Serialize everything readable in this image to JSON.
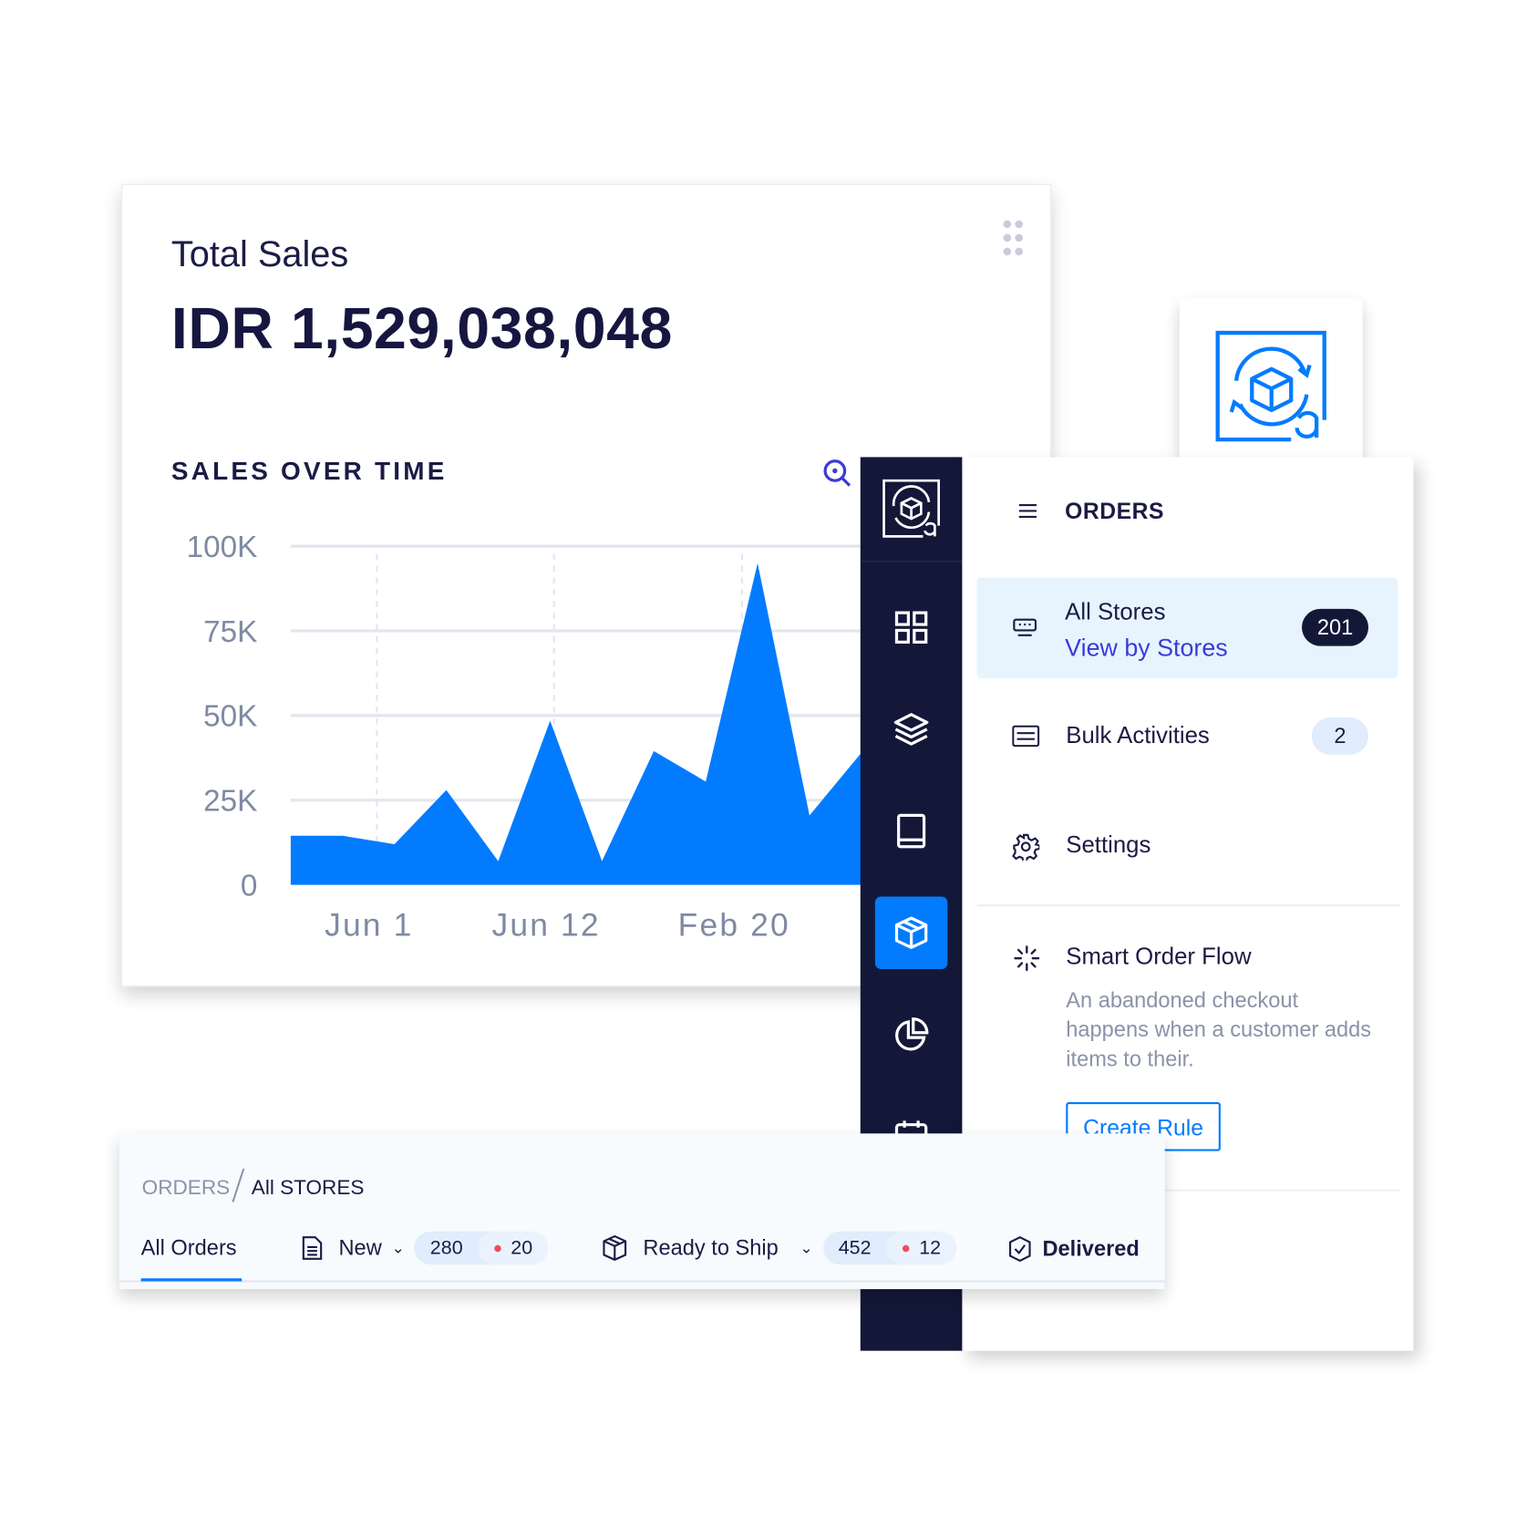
{
  "sales_card": {
    "title": "Total Sales",
    "amount": "IDR 1,529,038,048",
    "chart_title": "SALES OVER TIME"
  },
  "chart_data": {
    "type": "area",
    "title": "SALES OVER TIME",
    "y_ticks": [
      "100K",
      "75K",
      "50K",
      "25K",
      "0"
    ],
    "y_tick_values": [
      100000,
      75000,
      50000,
      25000,
      0
    ],
    "x_ticks": [
      "Jun 1",
      "Jun 12",
      "Feb 20"
    ],
    "values": [
      14500,
      14500,
      12000,
      28000,
      7000,
      48500,
      7000,
      39500,
      30500,
      95000,
      20500,
      39000
    ],
    "ylim": [
      0,
      100000
    ],
    "grid": true,
    "color": "#037bff"
  },
  "rail": {
    "items": [
      {
        "icon": "grid-icon"
      },
      {
        "icon": "layers-icon"
      },
      {
        "icon": "book-icon"
      },
      {
        "icon": "box-icon",
        "active": true
      },
      {
        "icon": "pie-chart-icon"
      },
      {
        "icon": "calendar-icon"
      }
    ]
  },
  "panel": {
    "header": "ORDERS",
    "items": [
      {
        "label": "All Stores",
        "link": "View by Stores",
        "badge": "201"
      },
      {
        "label": "Bulk Activities",
        "badge": "2"
      },
      {
        "label": "Settings"
      }
    ],
    "smart_flow": {
      "title": "Smart Order Flow",
      "description": "An abandoned checkout happens when a customer adds items to their.",
      "button": "Create Rule"
    }
  },
  "orders_bar": {
    "breadcrumb": [
      "ORDERS",
      "All STORES"
    ],
    "tabs": [
      {
        "label": "All Orders"
      },
      {
        "label": "New",
        "count": "280",
        "alert": "20"
      },
      {
        "label": "Ready to Ship",
        "count": "452",
        "alert": "12"
      },
      {
        "label": "Delivered"
      }
    ]
  },
  "colors": {
    "accent": "#037bff",
    "navy": "#141838",
    "text": "#1b1b45",
    "alert": "#f04b5f"
  }
}
